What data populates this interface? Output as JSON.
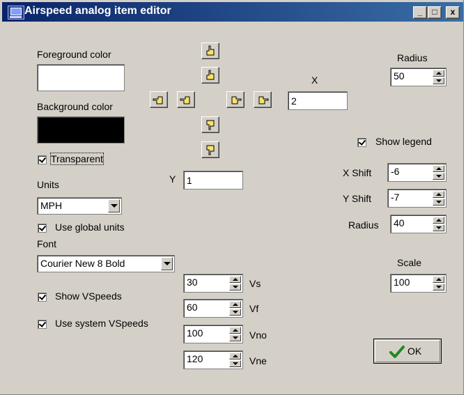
{
  "window": {
    "title": "Airspeed analog item editor",
    "minimize_label": "_",
    "maximize_label": "□",
    "close_label": "x"
  },
  "colors": {
    "foreground": "#ffffff",
    "background": "#000000",
    "title_start": "#0a246a",
    "title_end": "#3a6ea5",
    "dialog_face": "#d4d0c8",
    "check_mark": "#1f8a1f"
  },
  "left": {
    "foreground_label": "Foreground color",
    "background_label": "Background color",
    "transparent_label": "Transparent",
    "transparent_checked": true,
    "units_label": "Units",
    "units_value": "MPH",
    "use_global_units_label": "Use global units",
    "use_global_units_checked": true,
    "font_label": "Font",
    "font_value": "Courier New 8 Bold",
    "show_vspeeds_label": "Show VSpeeds",
    "show_vspeeds_checked": true,
    "use_system_vspeeds_label": "Use system VSpeeds",
    "use_system_vspeeds_checked": true
  },
  "position": {
    "x_label": "X",
    "x_value": "2",
    "y_label": "Y",
    "y_value": "1",
    "icons": {
      "up": "hand-pointing-up-icon",
      "down": "hand-pointing-down-icon",
      "left": "hand-pointing-left-icon",
      "right": "hand-pointing-right-icon"
    }
  },
  "radius": {
    "label": "Radius",
    "value": "50"
  },
  "legend": {
    "show_label": "Show legend",
    "show_checked": true,
    "x_shift_label": "X Shift",
    "x_shift_value": "-6",
    "y_shift_label": "Y Shift",
    "y_shift_value": "-7",
    "radius_label": "Radius",
    "radius_value": "40"
  },
  "scale": {
    "label": "Scale",
    "value": "100"
  },
  "vspeeds": [
    {
      "value": "30",
      "label": "Vs"
    },
    {
      "value": "60",
      "label": "Vf"
    },
    {
      "value": "100",
      "label": "Vno"
    },
    {
      "value": "120",
      "label": "Vne"
    }
  ],
  "ok": {
    "label": "OK",
    "icon": "green-checkmark-icon"
  }
}
